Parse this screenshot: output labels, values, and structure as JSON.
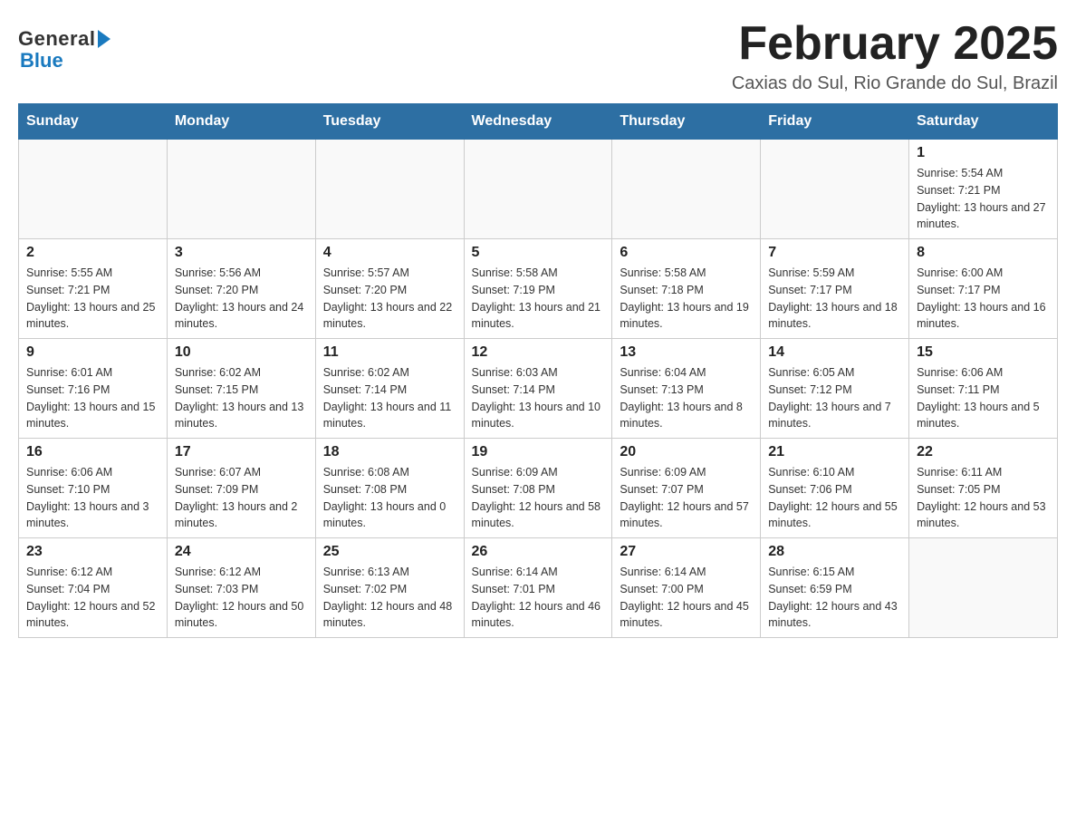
{
  "logo": {
    "general": "General",
    "blue": "Blue"
  },
  "title": "February 2025",
  "subtitle": "Caxias do Sul, Rio Grande do Sul, Brazil",
  "days_of_week": [
    "Sunday",
    "Monday",
    "Tuesday",
    "Wednesday",
    "Thursday",
    "Friday",
    "Saturday"
  ],
  "weeks": [
    [
      {
        "day": "",
        "info": ""
      },
      {
        "day": "",
        "info": ""
      },
      {
        "day": "",
        "info": ""
      },
      {
        "day": "",
        "info": ""
      },
      {
        "day": "",
        "info": ""
      },
      {
        "day": "",
        "info": ""
      },
      {
        "day": "1",
        "info": "Sunrise: 5:54 AM\nSunset: 7:21 PM\nDaylight: 13 hours and 27 minutes."
      }
    ],
    [
      {
        "day": "2",
        "info": "Sunrise: 5:55 AM\nSunset: 7:21 PM\nDaylight: 13 hours and 25 minutes."
      },
      {
        "day": "3",
        "info": "Sunrise: 5:56 AM\nSunset: 7:20 PM\nDaylight: 13 hours and 24 minutes."
      },
      {
        "day": "4",
        "info": "Sunrise: 5:57 AM\nSunset: 7:20 PM\nDaylight: 13 hours and 22 minutes."
      },
      {
        "day": "5",
        "info": "Sunrise: 5:58 AM\nSunset: 7:19 PM\nDaylight: 13 hours and 21 minutes."
      },
      {
        "day": "6",
        "info": "Sunrise: 5:58 AM\nSunset: 7:18 PM\nDaylight: 13 hours and 19 minutes."
      },
      {
        "day": "7",
        "info": "Sunrise: 5:59 AM\nSunset: 7:17 PM\nDaylight: 13 hours and 18 minutes."
      },
      {
        "day": "8",
        "info": "Sunrise: 6:00 AM\nSunset: 7:17 PM\nDaylight: 13 hours and 16 minutes."
      }
    ],
    [
      {
        "day": "9",
        "info": "Sunrise: 6:01 AM\nSunset: 7:16 PM\nDaylight: 13 hours and 15 minutes."
      },
      {
        "day": "10",
        "info": "Sunrise: 6:02 AM\nSunset: 7:15 PM\nDaylight: 13 hours and 13 minutes."
      },
      {
        "day": "11",
        "info": "Sunrise: 6:02 AM\nSunset: 7:14 PM\nDaylight: 13 hours and 11 minutes."
      },
      {
        "day": "12",
        "info": "Sunrise: 6:03 AM\nSunset: 7:14 PM\nDaylight: 13 hours and 10 minutes."
      },
      {
        "day": "13",
        "info": "Sunrise: 6:04 AM\nSunset: 7:13 PM\nDaylight: 13 hours and 8 minutes."
      },
      {
        "day": "14",
        "info": "Sunrise: 6:05 AM\nSunset: 7:12 PM\nDaylight: 13 hours and 7 minutes."
      },
      {
        "day": "15",
        "info": "Sunrise: 6:06 AM\nSunset: 7:11 PM\nDaylight: 13 hours and 5 minutes."
      }
    ],
    [
      {
        "day": "16",
        "info": "Sunrise: 6:06 AM\nSunset: 7:10 PM\nDaylight: 13 hours and 3 minutes."
      },
      {
        "day": "17",
        "info": "Sunrise: 6:07 AM\nSunset: 7:09 PM\nDaylight: 13 hours and 2 minutes."
      },
      {
        "day": "18",
        "info": "Sunrise: 6:08 AM\nSunset: 7:08 PM\nDaylight: 13 hours and 0 minutes."
      },
      {
        "day": "19",
        "info": "Sunrise: 6:09 AM\nSunset: 7:08 PM\nDaylight: 12 hours and 58 minutes."
      },
      {
        "day": "20",
        "info": "Sunrise: 6:09 AM\nSunset: 7:07 PM\nDaylight: 12 hours and 57 minutes."
      },
      {
        "day": "21",
        "info": "Sunrise: 6:10 AM\nSunset: 7:06 PM\nDaylight: 12 hours and 55 minutes."
      },
      {
        "day": "22",
        "info": "Sunrise: 6:11 AM\nSunset: 7:05 PM\nDaylight: 12 hours and 53 minutes."
      }
    ],
    [
      {
        "day": "23",
        "info": "Sunrise: 6:12 AM\nSunset: 7:04 PM\nDaylight: 12 hours and 52 minutes."
      },
      {
        "day": "24",
        "info": "Sunrise: 6:12 AM\nSunset: 7:03 PM\nDaylight: 12 hours and 50 minutes."
      },
      {
        "day": "25",
        "info": "Sunrise: 6:13 AM\nSunset: 7:02 PM\nDaylight: 12 hours and 48 minutes."
      },
      {
        "day": "26",
        "info": "Sunrise: 6:14 AM\nSunset: 7:01 PM\nDaylight: 12 hours and 46 minutes."
      },
      {
        "day": "27",
        "info": "Sunrise: 6:14 AM\nSunset: 7:00 PM\nDaylight: 12 hours and 45 minutes."
      },
      {
        "day": "28",
        "info": "Sunrise: 6:15 AM\nSunset: 6:59 PM\nDaylight: 12 hours and 43 minutes."
      },
      {
        "day": "",
        "info": ""
      }
    ]
  ]
}
